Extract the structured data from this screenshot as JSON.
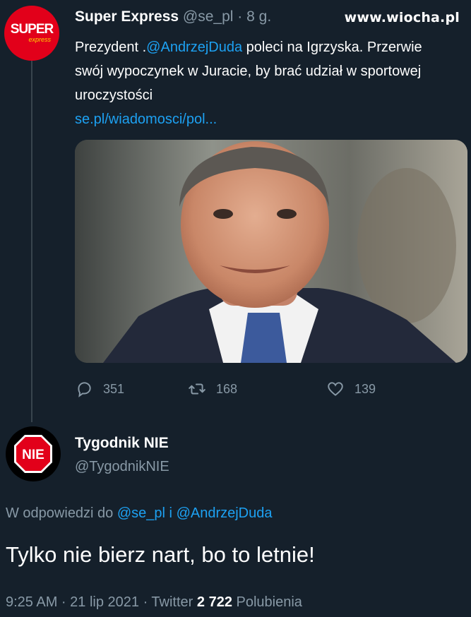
{
  "watermark": "www.wiocha.pl",
  "tweet1": {
    "avatar": {
      "top": "SUPER",
      "bottom": "express"
    },
    "name": "Super Express",
    "handle": "@se_pl",
    "dot": "·",
    "time": "8 g.",
    "text_part1": "Prezydent .",
    "mention": "@AndrzejDuda",
    "text_part2": " poleci na Igrzyska. Przerwie swój wypoczynek w Juracie, by brać udział w sportowej uroczystości",
    "link": "se.pl/wiadomosci/pol...",
    "replies": "351",
    "retweets": "168",
    "likes": "139"
  },
  "tweet2": {
    "avatar_text": "NIE",
    "name": "Tygodnik NIE",
    "handle": "@TygodnikNIE",
    "reply_prefix": "W odpowiedzi do ",
    "reply_mention1": "@se_pl",
    "reply_joiner": " i ",
    "reply_mention2": "@AndrzejDuda",
    "text": "Tylko nie bierz nart, bo to letnie!",
    "time": "9:25 AM · 21 lip 2021 · Twitter",
    "likes_count": "2 722",
    "likes_label": "Polubienia"
  },
  "colors": {
    "background": "#15202b",
    "link": "#1da1f2",
    "muted": "#8899a6",
    "super_red": "#e2001a"
  }
}
